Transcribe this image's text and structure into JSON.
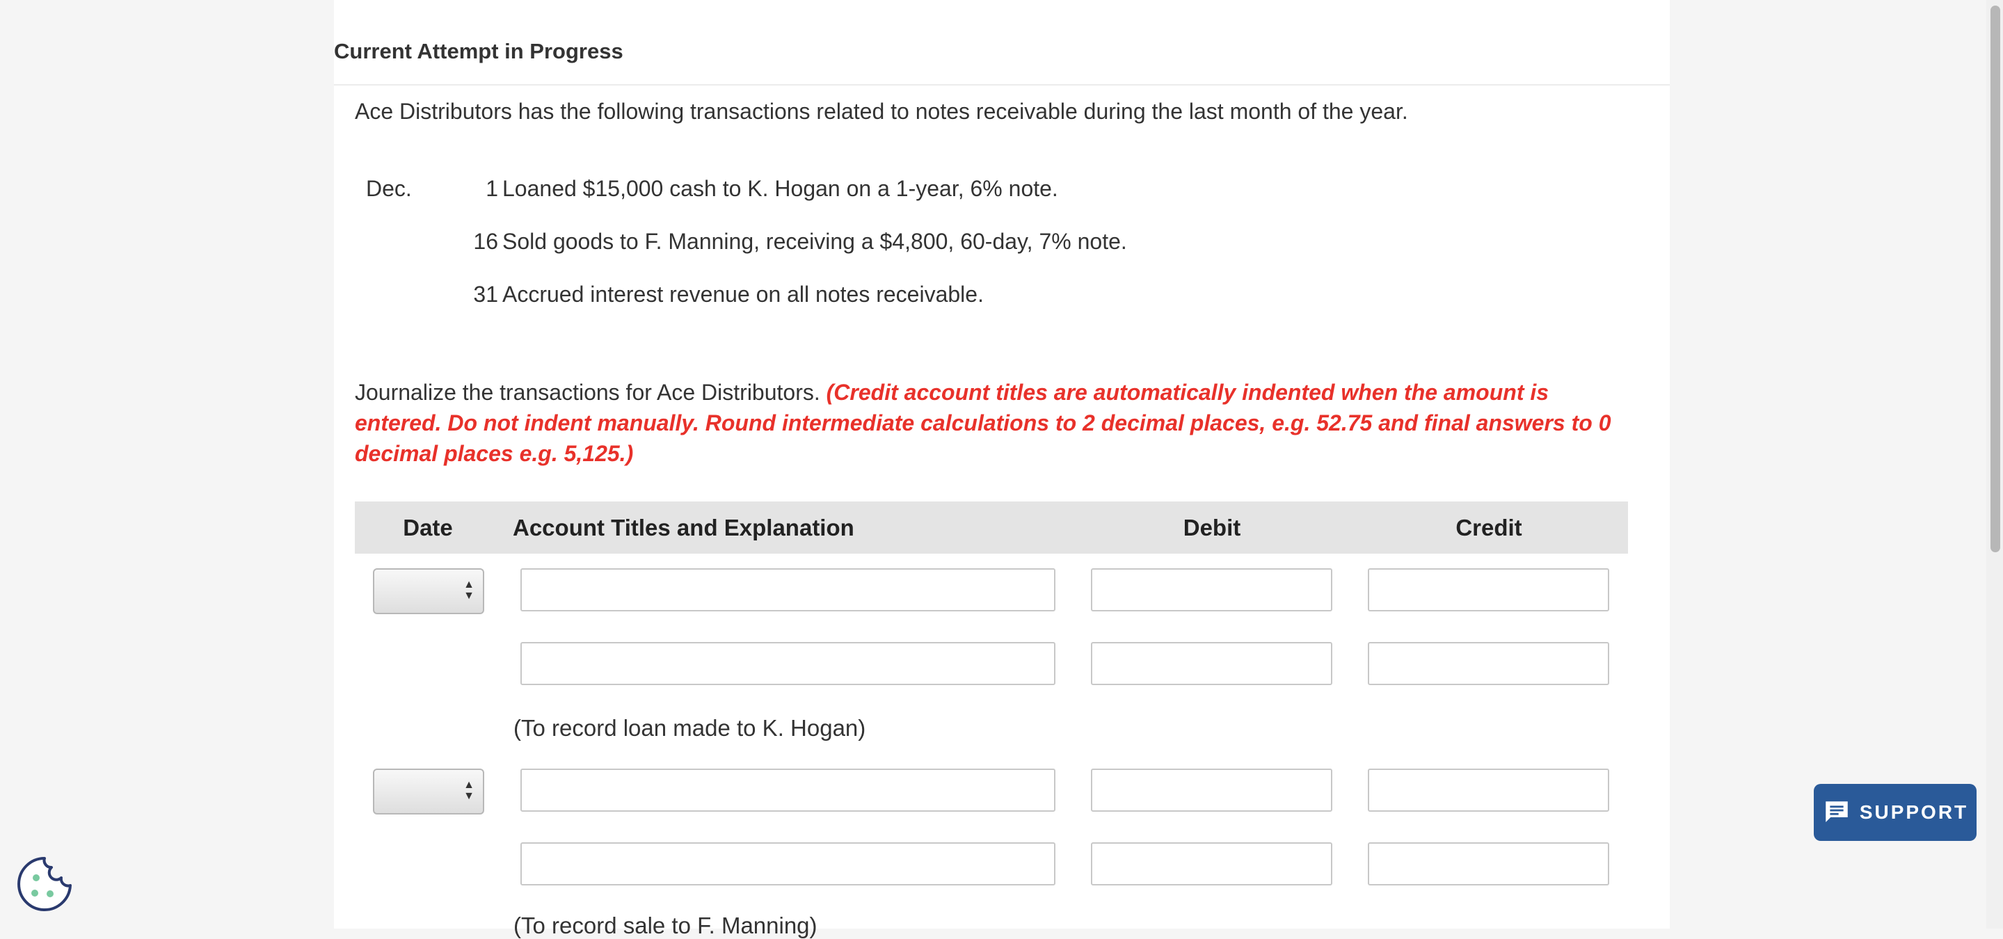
{
  "heading": "Current Attempt in Progress",
  "intro": "Ace Distributors has the following transactions related to notes receivable during the last month of the year.",
  "transactions": [
    {
      "month": "Dec.",
      "day": "1",
      "description": "Loaned $15,000 cash to K. Hogan on a 1-year, 6% note."
    },
    {
      "month": "",
      "day": "16",
      "description": "Sold goods to F. Manning, receiving a $4,800, 60-day, 7% note."
    },
    {
      "month": "",
      "day": "31",
      "description": "Accrued interest revenue on all notes receivable."
    }
  ],
  "instructions": {
    "plain": "Journalize the transactions for Ace Distributors. ",
    "emphasis": "(Credit account titles are automatically indented when the amount is entered. Do not indent manually. Round intermediate calculations to 2 decimal places, e.g. 52.75 and final answers to 0 decimal places e.g. 5,125.)"
  },
  "table": {
    "headers": {
      "date": "Date",
      "account": "Account Titles and Explanation",
      "debit": "Debit",
      "credit": "Credit"
    },
    "entries": [
      {
        "date": "",
        "lines": [
          {
            "account": "",
            "debit": "",
            "credit": ""
          },
          {
            "account": "",
            "debit": "",
            "credit": ""
          }
        ],
        "note": "(To record loan made to K. Hogan)"
      },
      {
        "date": "",
        "lines": [
          {
            "account": "",
            "debit": "",
            "credit": ""
          },
          {
            "account": "",
            "debit": "",
            "credit": ""
          }
        ],
        "note": "(To record sale to F. Manning)"
      }
    ]
  },
  "support": {
    "label": "SUPPORT",
    "icon": "chat-icon"
  },
  "cookie": {
    "icon": "cookie-icon"
  },
  "colors": {
    "accent": "#2a5a99",
    "emphasis": "#e8312a",
    "header_bg": "#e4e4e4"
  }
}
